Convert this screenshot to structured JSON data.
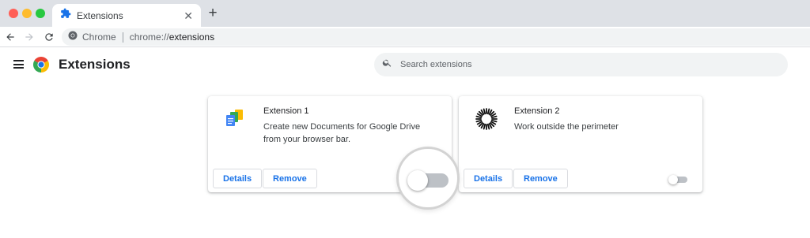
{
  "window": {
    "traffic_colors": [
      "#ff5f57",
      "#febc2e",
      "#28c840"
    ]
  },
  "tab": {
    "title": "Extensions",
    "icon": "puzzle-piece-icon",
    "close_icon": "close-icon",
    "new_tab_icon": "plus-icon"
  },
  "toolbar": {
    "site_chip": "Chrome",
    "url_scheme": "chrome://",
    "url_host": "extensions"
  },
  "header": {
    "title": "Extensions",
    "search_placeholder": "Search extensions"
  },
  "extensions": [
    {
      "name": "Extension 1",
      "description": "Create new Documents for Google Drive from your browser bar.",
      "details_label": "Details",
      "remove_label": "Remove",
      "enabled": false,
      "icon": "google-docs-icon"
    },
    {
      "name": "Extension 2",
      "description": "Work outside the perimeter",
      "details_label": "Details",
      "remove_label": "Remove",
      "enabled": false,
      "icon": "sunburst-icon"
    }
  ],
  "colors": {
    "accent": "#1a73e8",
    "tab_strip": "#dee1e6",
    "search_bg": "#f1f3f4",
    "toggle_off": "#bdc1c6"
  }
}
